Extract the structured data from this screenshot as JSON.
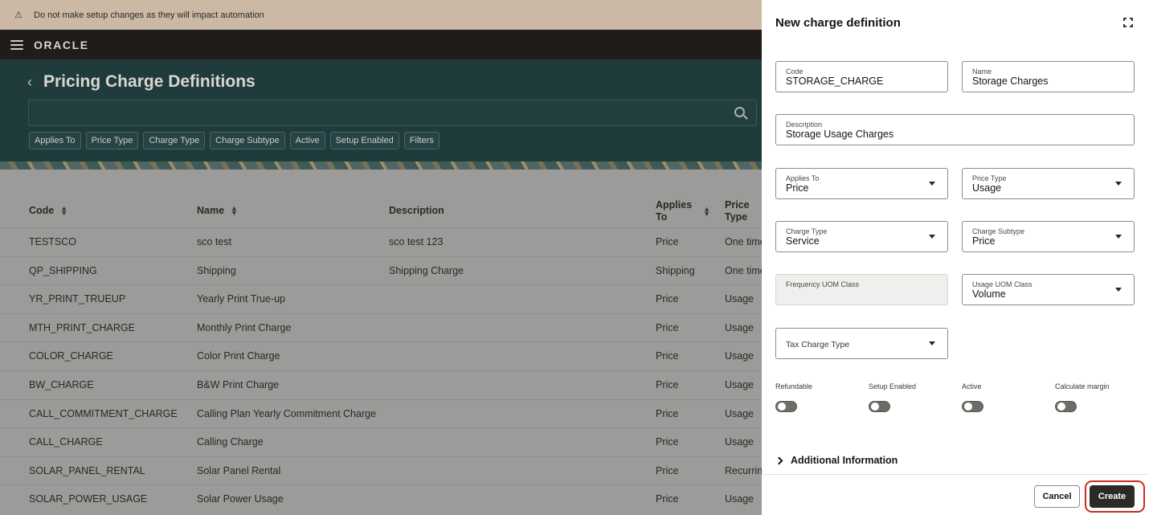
{
  "warning": {
    "text": "Do not make setup changes as they will impact automation"
  },
  "header": {
    "logo": "ORACLE"
  },
  "page": {
    "title": "Pricing Charge Definitions",
    "filters": [
      "Applies To",
      "Price Type",
      "Charge Type",
      "Charge Subtype",
      "Active",
      "Setup Enabled",
      "Filters"
    ]
  },
  "table": {
    "columns": {
      "code": "Code",
      "name": "Name",
      "description": "Description",
      "applies_to_1": "Applies",
      "applies_to_2": "To",
      "price_type_1": "Price",
      "price_type_2": "Type"
    },
    "rows": [
      {
        "code": "TESTSCO",
        "name": "sco test",
        "description": "sco test 123",
        "applies_to": "Price",
        "price_type": "One time"
      },
      {
        "code": "QP_SHIPPING",
        "name": "Shipping",
        "description": "Shipping Charge",
        "applies_to": "Shipping",
        "price_type": "One time"
      },
      {
        "code": "YR_PRINT_TRUEUP",
        "name": "Yearly Print True-up",
        "description": "",
        "applies_to": "Price",
        "price_type": "Usage"
      },
      {
        "code": "MTH_PRINT_CHARGE",
        "name": "Monthly Print Charge",
        "description": "",
        "applies_to": "Price",
        "price_type": "Usage"
      },
      {
        "code": "COLOR_CHARGE",
        "name": "Color Print Charge",
        "description": "",
        "applies_to": "Price",
        "price_type": "Usage"
      },
      {
        "code": "BW_CHARGE",
        "name": "B&W Print Charge",
        "description": "",
        "applies_to": "Price",
        "price_type": "Usage"
      },
      {
        "code": "CALL_COMMITMENT_CHARGE",
        "name": "Calling Plan Yearly Commitment Charge",
        "description": "",
        "applies_to": "Price",
        "price_type": "Usage"
      },
      {
        "code": "CALL_CHARGE",
        "name": "Calling Charge",
        "description": "",
        "applies_to": "Price",
        "price_type": "Usage"
      },
      {
        "code": "SOLAR_PANEL_RENTAL",
        "name": "Solar Panel Rental",
        "description": "",
        "applies_to": "Price",
        "price_type": "Recurring"
      },
      {
        "code": "SOLAR_POWER_USAGE",
        "name": "Solar Power Usage",
        "description": "",
        "applies_to": "Price",
        "price_type": "Usage"
      }
    ]
  },
  "drawer": {
    "title": "New charge definition",
    "fields": {
      "code": {
        "label": "Code",
        "value": "STORAGE_CHARGE"
      },
      "name": {
        "label": "Name",
        "value": "Storage Charges"
      },
      "description": {
        "label": "Description",
        "value": "Storage Usage Charges"
      },
      "applies_to": {
        "label": "Applies To",
        "value": "Price"
      },
      "price_type": {
        "label": "Price Type",
        "value": "Usage"
      },
      "charge_type": {
        "label": "Charge Type",
        "value": "Service"
      },
      "charge_subtype": {
        "label": "Charge Subtype",
        "value": "Price"
      },
      "frequency_uom_class": {
        "label": "Frequency UOM Class",
        "value": ""
      },
      "usage_uom_class": {
        "label": "Usage UOM Class",
        "value": "Volume"
      },
      "tax_charge_type": {
        "label": "Tax Charge Type",
        "value": ""
      }
    },
    "toggles": {
      "refundable": "Refundable",
      "setup_enabled": "Setup Enabled",
      "active": "Active",
      "calculate_margin": "Calculate margin"
    },
    "additional_info": "Additional Information",
    "buttons": {
      "cancel": "Cancel",
      "create": "Create"
    }
  },
  "colors": {
    "accent_highlight": "#d02a20",
    "primary_button": "#2c2a27",
    "hero_background": "#1f3b3c"
  }
}
